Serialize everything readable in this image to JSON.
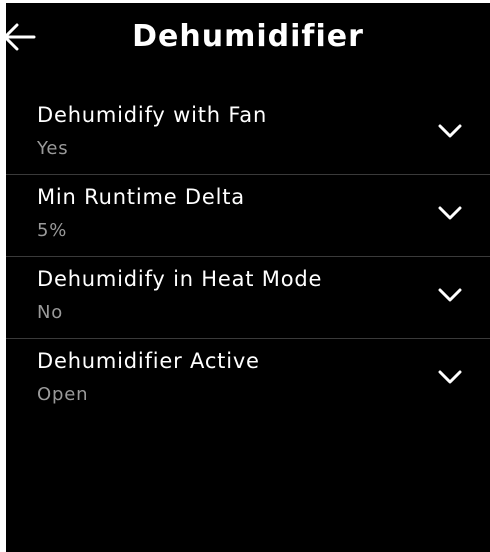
{
  "header": {
    "title": "Dehumidifier",
    "back_icon": "arrow-left-icon"
  },
  "settings": [
    {
      "label": "Dehumidify with Fan",
      "value": "Yes",
      "icon": "chevron-down-icon"
    },
    {
      "label": "Min Runtime Delta",
      "value": "5%",
      "icon": "chevron-down-icon"
    },
    {
      "label": "Dehumidify in Heat Mode",
      "value": "No",
      "icon": "chevron-down-icon"
    },
    {
      "label": "Dehumidifier Active",
      "value": "Open",
      "icon": "chevron-down-icon"
    }
  ],
  "colors": {
    "background": "#000000",
    "text": "#ffffff",
    "secondary_text": "#9a9a9a",
    "divider": "#3a3a3a"
  }
}
